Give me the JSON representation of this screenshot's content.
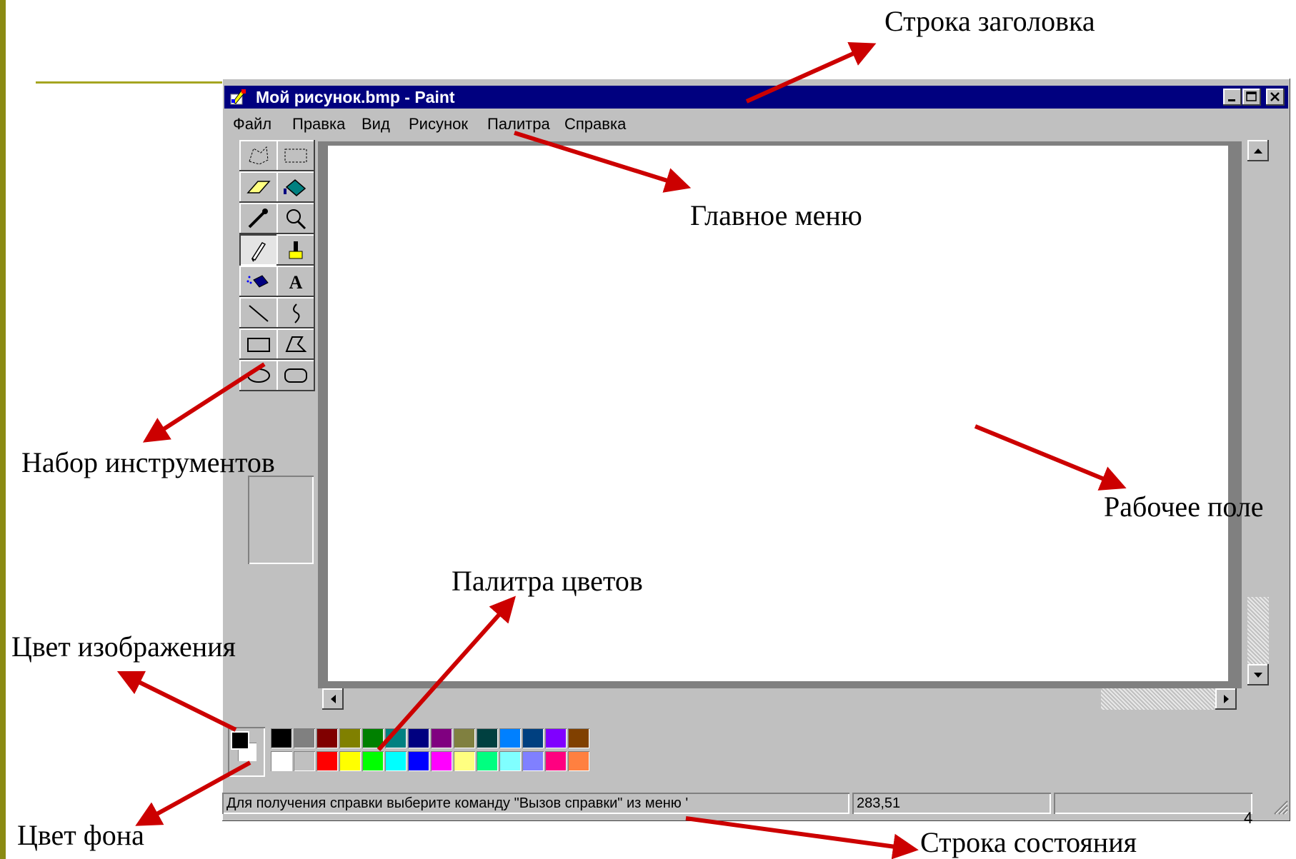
{
  "window": {
    "title": "Мой рисунок.bmp - Paint",
    "icon": "paint-app-icon",
    "controls": [
      "minimize-icon",
      "maximize-icon",
      "close-icon"
    ]
  },
  "menu": {
    "items": [
      "Файл",
      "Правка",
      "Вид",
      "Рисунок",
      "Палитра",
      "Справка"
    ]
  },
  "toolbox": {
    "tools": [
      "free-select-icon",
      "rect-select-icon",
      "eraser-icon",
      "fill-icon",
      "color-picker-icon",
      "magnifier-icon",
      "pencil-icon",
      "brush-icon",
      "airbrush-icon",
      "text-icon",
      "line-icon",
      "curve-icon",
      "rectangle-icon",
      "polygon-icon",
      "ellipse-icon",
      "rounded-rect-icon"
    ],
    "active_tool": "pencil-icon",
    "text_tool_glyph": "A"
  },
  "colors": {
    "foreground": "#000000",
    "background": "#ffffff",
    "palette_top": [
      "#000000",
      "#808080",
      "#800000",
      "#808000",
      "#008000",
      "#008080",
      "#000080",
      "#800080",
      "#808040",
      "#004040",
      "#0080ff",
      "#004080",
      "#8000ff",
      "#804000"
    ],
    "palette_bottom": [
      "#ffffff",
      "#c0c0c0",
      "#ff0000",
      "#ffff00",
      "#00ff00",
      "#00ffff",
      "#0000ff",
      "#ff00ff",
      "#ffff80",
      "#00ff80",
      "#80ffff",
      "#8080ff",
      "#ff0080",
      "#ff8040"
    ],
    "annotation_arrow": "#cc0000"
  },
  "statusbar": {
    "hint": "Для получения справки выберите команду \"Вызов справки\" из меню '",
    "coords": "283,51",
    "size": ""
  },
  "annotations": {
    "title_bar": "Строка  заголовка",
    "main_menu": "Главное меню",
    "toolbox": "Набор инструментов",
    "work_area": "Рабочее поле",
    "palette": "Палитра цветов",
    "fg_color": "Цвет изображения",
    "bg_color": "Цвет фона",
    "status_bar": "Строка состояния"
  },
  "slide_number": "4"
}
